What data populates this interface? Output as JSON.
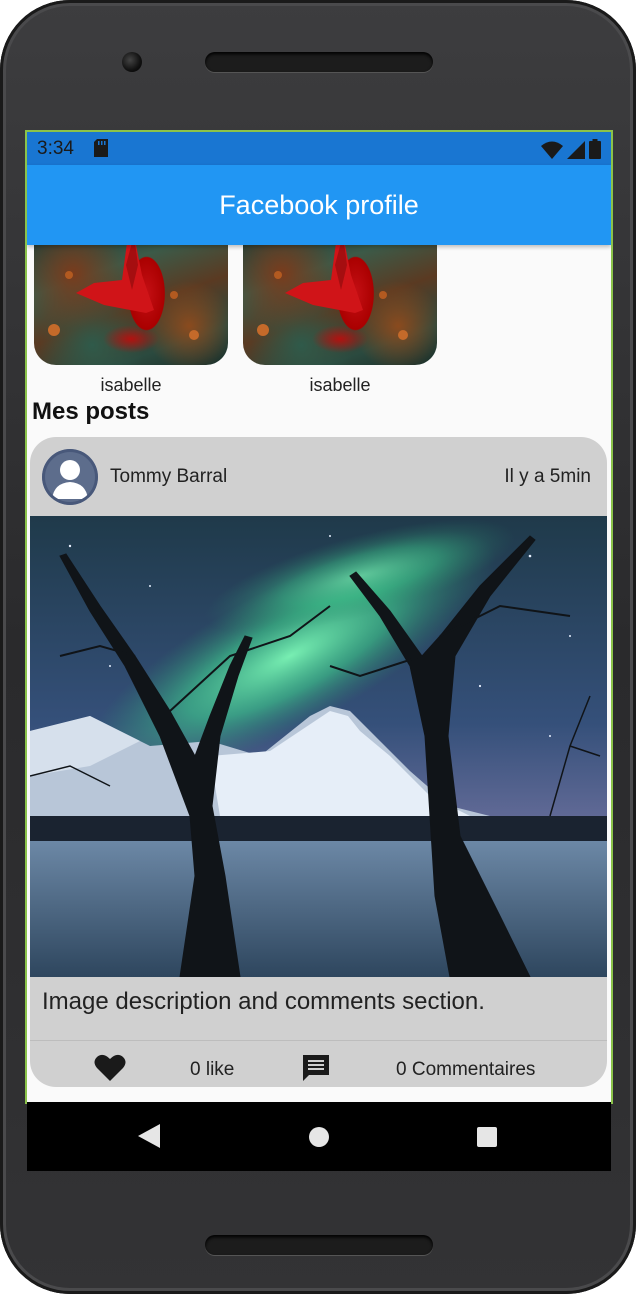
{
  "status_bar": {
    "time": "3:34",
    "icons": [
      "sd-card-icon",
      "wifi-icon",
      "signal-icon",
      "battery-icon"
    ]
  },
  "app_bar": {
    "title": "Facebook profile"
  },
  "friends": [
    {
      "name": "isabelle"
    },
    {
      "name": "isabelle"
    }
  ],
  "posts_section": {
    "title": "Mes posts"
  },
  "post": {
    "author": "Tommy Barral",
    "time": "Il y a 5min",
    "description": "Image description and comments section.",
    "likes_label": "0 like",
    "comments_label": "0 Commentaires"
  },
  "colors": {
    "status_bar": "#1976d2",
    "app_bar": "#2196f3",
    "card_background": "#d0d0d0",
    "screen_background": "#fafafa"
  }
}
